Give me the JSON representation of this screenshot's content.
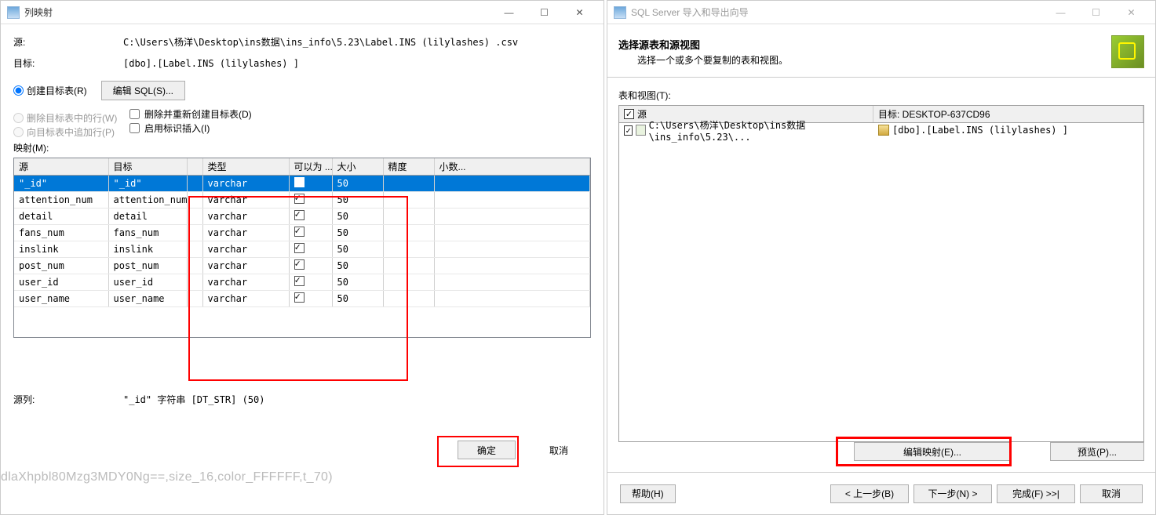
{
  "left": {
    "title": "列映射",
    "source_label": "源:",
    "source_value": "C:\\Users\\杨洋\\Desktop\\ins数据\\ins_info\\5.23\\Label.INS (lilylashes) .csv",
    "target_label": "目标:",
    "target_value": "[dbo].[Label.INS (lilylashes) ]",
    "radio_create": "创建目标表(R)",
    "edit_sql_btn": "编辑 SQL(S)...",
    "radio_delete_rows": "删除目标表中的行(W)",
    "chk_drop_recreate": "删除并重新创建目标表(D)",
    "radio_append": "向目标表中追加行(P)",
    "chk_identity": "启用标识插入(I)",
    "map_label": "映射(M):",
    "cols": {
      "src": "源",
      "dst": "目标",
      "type": "类型",
      "nullable": "可以为 ...",
      "size": "大小",
      "prec": "精度",
      "scale": "小数..."
    },
    "rows": [
      {
        "src": "\"_id\"",
        "dst": "\"_id\"",
        "type": "varchar",
        "null": true,
        "size": "50",
        "sel": true
      },
      {
        "src": "attention_num",
        "dst": "attention_num",
        "type": "varchar",
        "null": true,
        "size": "50"
      },
      {
        "src": "detail",
        "dst": "detail",
        "type": "varchar",
        "null": true,
        "size": "50"
      },
      {
        "src": "fans_num",
        "dst": "fans_num",
        "type": "varchar",
        "null": true,
        "size": "50"
      },
      {
        "src": "inslink",
        "dst": "inslink",
        "type": "varchar",
        "null": true,
        "size": "50"
      },
      {
        "src": "post_num",
        "dst": "post_num",
        "type": "varchar",
        "null": true,
        "size": "50"
      },
      {
        "src": "user_id",
        "dst": "user_id",
        "type": "varchar",
        "null": true,
        "size": "50"
      },
      {
        "src": "user_name",
        "dst": "user_name",
        "type": "varchar",
        "null": true,
        "size": "50"
      }
    ],
    "src_col_label": "源列:",
    "src_col_value": "\"_id\" 字符串 [DT_STR] (50)",
    "ok": "确定",
    "cancel": "取消",
    "watermark": "dlaXhpbl80Mzg3MDY0Ng==,size_16,color_FFFFFF,t_70)"
  },
  "right": {
    "title": "SQL Server 导入和导出向导",
    "h1": "选择源表和源视图",
    "h2": "选择一个或多个要复制的表和视图。",
    "tv_label": "表和视图(T):",
    "head_src": "源",
    "head_dst": "目标: DESKTOP-637CD96",
    "row_src": "C:\\Users\\杨洋\\Desktop\\ins数据\\ins_info\\5.23\\...",
    "row_dst": "[dbo].[Label.INS (lilylashes) ]",
    "edit_map_btn": "编辑映射(E)...",
    "preview_btn": "预览(P)...",
    "help": "帮助(H)",
    "back": "< 上一步(B)",
    "next": "下一步(N) >",
    "finish": "完成(F) >>|",
    "cancel": "取消"
  }
}
